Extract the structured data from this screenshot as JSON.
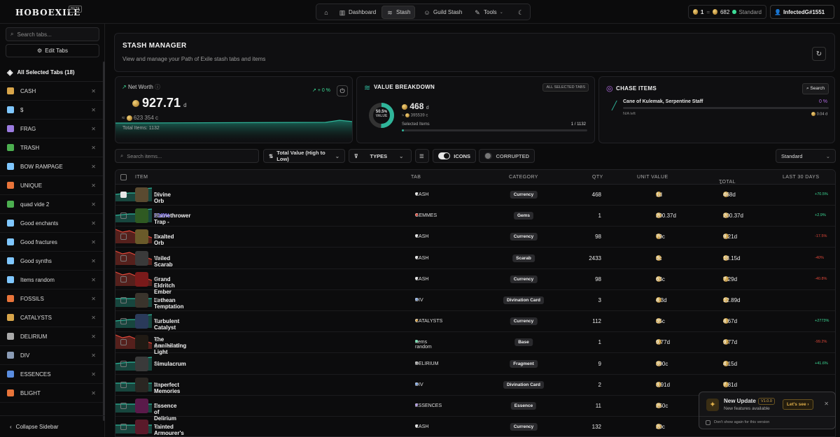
{
  "brand": {
    "logo": "HOBOEXILE",
    "beta": "BETA"
  },
  "nav": {
    "dashboard": "Dashboard",
    "stash": "Stash",
    "guild": "Guild Stash",
    "tools": "Tools"
  },
  "price": {
    "left": "1",
    "eq": "=",
    "right": "682",
    "league": "Standard"
  },
  "user": {
    "name": "InfectedG#1551"
  },
  "sidebar": {
    "search_placeholder": "Search tabs...",
    "edit_label": "Edit Tabs",
    "all_label": "All Selected Tabs (18)",
    "items": [
      {
        "label": "CASH",
        "color": "#d8a54a"
      },
      {
        "label": "$",
        "color": "#7fc7ff"
      },
      {
        "label": "FRAG",
        "color": "#9b7be0"
      },
      {
        "label": "TRASH",
        "color": "#4caf50"
      },
      {
        "label": "BOW RAMPAGE",
        "color": "#7fc7ff"
      },
      {
        "label": "UNIQUE",
        "color": "#e8743a"
      },
      {
        "label": "quad vide 2",
        "color": "#4caf50"
      },
      {
        "label": "Good enchants",
        "color": "#7fc7ff"
      },
      {
        "label": "Good fractures",
        "color": "#7fc7ff"
      },
      {
        "label": "Good synths",
        "color": "#7fc7ff"
      },
      {
        "label": "Items random",
        "color": "#7fc7ff"
      },
      {
        "label": "FOSSILS",
        "color": "#e8743a"
      },
      {
        "label": "CATALYSTS",
        "color": "#d8a54a"
      },
      {
        "label": "DELIRIUM",
        "color": "#aaaaaa"
      },
      {
        "label": "DIV",
        "color": "#8a9bb5"
      },
      {
        "label": "ESSENCES",
        "color": "#5a8de0"
      },
      {
        "label": "BLIGHT",
        "color": "#e8743a"
      }
    ],
    "collapse_label": "Collapse Sidebar"
  },
  "header": {
    "title": "STASH MANAGER",
    "subtitle": "View and manage your Path of Exile stash tabs and items"
  },
  "networth": {
    "label": "Net Worth",
    "value": "927.71",
    "unit": "d",
    "sub": "623 354",
    "sub_unit": "c",
    "pct": "+ 0 %",
    "total": "Total Items: 1132"
  },
  "breakdown": {
    "title": "VALUE BREAKDOWN",
    "tag": "ALL SELECTED TABS",
    "donut_pct": "50.5",
    "donut_pct_sign": "%",
    "donut_label": "VALUE",
    "donut_fraction": 0.505,
    "value": "468",
    "unit": "d",
    "sub": "395539",
    "sub_unit": "c",
    "selected_label": "Selected Items",
    "selected_val": "1 / 1132",
    "selected_fraction": 0.001
  },
  "chase": {
    "title": "CHASE ITEMS",
    "search_label": "Search",
    "item": "Cane of Kulemak, Serpentine Staff",
    "pct": "0 %",
    "left": "N/A left",
    "price": "0.04",
    "price_unit": "d"
  },
  "filters": {
    "search_placeholder": "Search items...",
    "sort": "Total Value (High to Low)",
    "types": "TYPES",
    "icons": "ICONS",
    "corrupted": "CORRUPTED",
    "league": "Standard"
  },
  "table": {
    "headers": {
      "item": "ITEM",
      "tab": "TAB",
      "category": "CATEGORY",
      "qty": "QTY",
      "unit": "UNIT VALUE",
      "total": "TOTAL",
      "last": "LAST 30 DAYS"
    },
    "rows": [
      {
        "checked": true,
        "name": "Divine Orb",
        "sub": "",
        "extra": "",
        "tab": "CASH",
        "tabcolor": "#e6e6e6",
        "cat": "Currency",
        "qty": "468",
        "unit": "1d",
        "total": "468d",
        "pct": "+70.5%",
        "pos": true,
        "icon": "#5a4a30"
      },
      {
        "checked": false,
        "name": "Flamethrower Trap - ",
        "sub": "",
        "extra": "20/0%",
        "tab": "GEMMES",
        "tabcolor": "#e0483a",
        "cat": "Gems",
        "qty": "1",
        "unit": "200.37d",
        "total": "200.37d",
        "pct": "+2.9%",
        "pos": true,
        "icon": "#2f5a22"
      },
      {
        "checked": false,
        "name": "Exalted Orb",
        "sub": "",
        "extra": "",
        "tab": "CASH",
        "tabcolor": "#e6e6e6",
        "cat": "Currency",
        "qty": "98",
        "unit": "79c",
        "total": "9.21d",
        "pct": "-17.5%",
        "pos": false,
        "icon": "#6a5a2a"
      },
      {
        "checked": false,
        "name": "Veiled Scarab",
        "sub": "",
        "extra": "",
        "tab": "CASH",
        "tabcolor": "#e6e6e6",
        "cat": "Scarab",
        "qty": "2433",
        "unit": "3c",
        "total": "18.15d",
        "pct": "-40%",
        "pos": false,
        "icon": "#3a3a3a"
      },
      {
        "checked": false,
        "name": "Grand Eldritch Ember",
        "sub": "",
        "extra": "",
        "tab": "CASH",
        "tabcolor": "#e6e6e6",
        "cat": "Currency",
        "qty": "98",
        "unit": "63c",
        "total": "7.29d",
        "pct": "-40.8%",
        "pos": false,
        "icon": "#7a1a1a"
      },
      {
        "checked": false,
        "name": "Lethean Temptation",
        "sub": "",
        "extra": "",
        "tab": "DIV",
        "tabcolor": "#7fa8e8",
        "cat": "Divination Card",
        "qty": "3",
        "unit": "4.3d",
        "total": "12.89d",
        "pct": "",
        "pos": true,
        "icon": "#3a342c"
      },
      {
        "checked": false,
        "name": "Turbulent Catalyst",
        "sub": "",
        "extra": "",
        "tab": "CATALYSTS",
        "tabcolor": "#d8a54a",
        "cat": "Currency",
        "qty": "112",
        "unit": "35c",
        "total": "4.67d",
        "pct": "+2773%",
        "pos": true,
        "icon": "#2a3a5a"
      },
      {
        "checked": false,
        "name": "The Annihilating Light",
        "sub": "Quarterstaff",
        "extra": "",
        "tab": "Items random",
        "tabcolor": "#3ddc97",
        "cat": "Base",
        "qty": "1",
        "unit": "9.77d",
        "total": "9.77d",
        "pct": "-99.2%",
        "pos": false,
        "icon": "#201a14"
      },
      {
        "checked": false,
        "name": "Simulacrum",
        "sub": "",
        "extra": "",
        "tab": "DELIRIUM",
        "tabcolor": "#aaaaaa",
        "cat": "Fragment",
        "qty": "9",
        "unit": "390c",
        "total": "4.15d",
        "pct": "+41.6%",
        "pos": true,
        "icon": "#3a3a3a"
      },
      {
        "checked": false,
        "name": "Imperfect Memories",
        "sub": "",
        "extra": "",
        "tab": "DIV",
        "tabcolor": "#7fa8e8",
        "cat": "Divination Card",
        "qty": "2",
        "unit": "3.91d",
        "total": "7.81d",
        "pct": "",
        "pos": true,
        "icon": "#2a2622"
      },
      {
        "checked": false,
        "name": "Essence of Delirium",
        "sub": "",
        "extra": "",
        "tab": "ESSENCES",
        "tabcolor": "#9b7be0",
        "cat": "Essence",
        "qty": "11",
        "unit": "250c",
        "total": "",
        "pct": "",
        "pos": true,
        "icon": "#5a1a4a"
      },
      {
        "checked": false,
        "name": "Tainted Armourer's Scrap",
        "sub": "",
        "extra": "",
        "tab": "CASH",
        "tabcolor": "#e6e6e6",
        "cat": "Currency",
        "qty": "132",
        "unit": "20c",
        "total": "",
        "pct": "",
        "pos": true,
        "icon": "#5a1a2a"
      }
    ]
  },
  "toast": {
    "title": "New Update",
    "version": "V1.0.0",
    "sub": "New features available",
    "btn": "Let's see",
    "check": "Don't show again for this version"
  },
  "colors": {
    "accent": "#2fb59a",
    "positive": "#3ddc97",
    "negative": "#e0483a",
    "bg": "#0b0b0c"
  }
}
